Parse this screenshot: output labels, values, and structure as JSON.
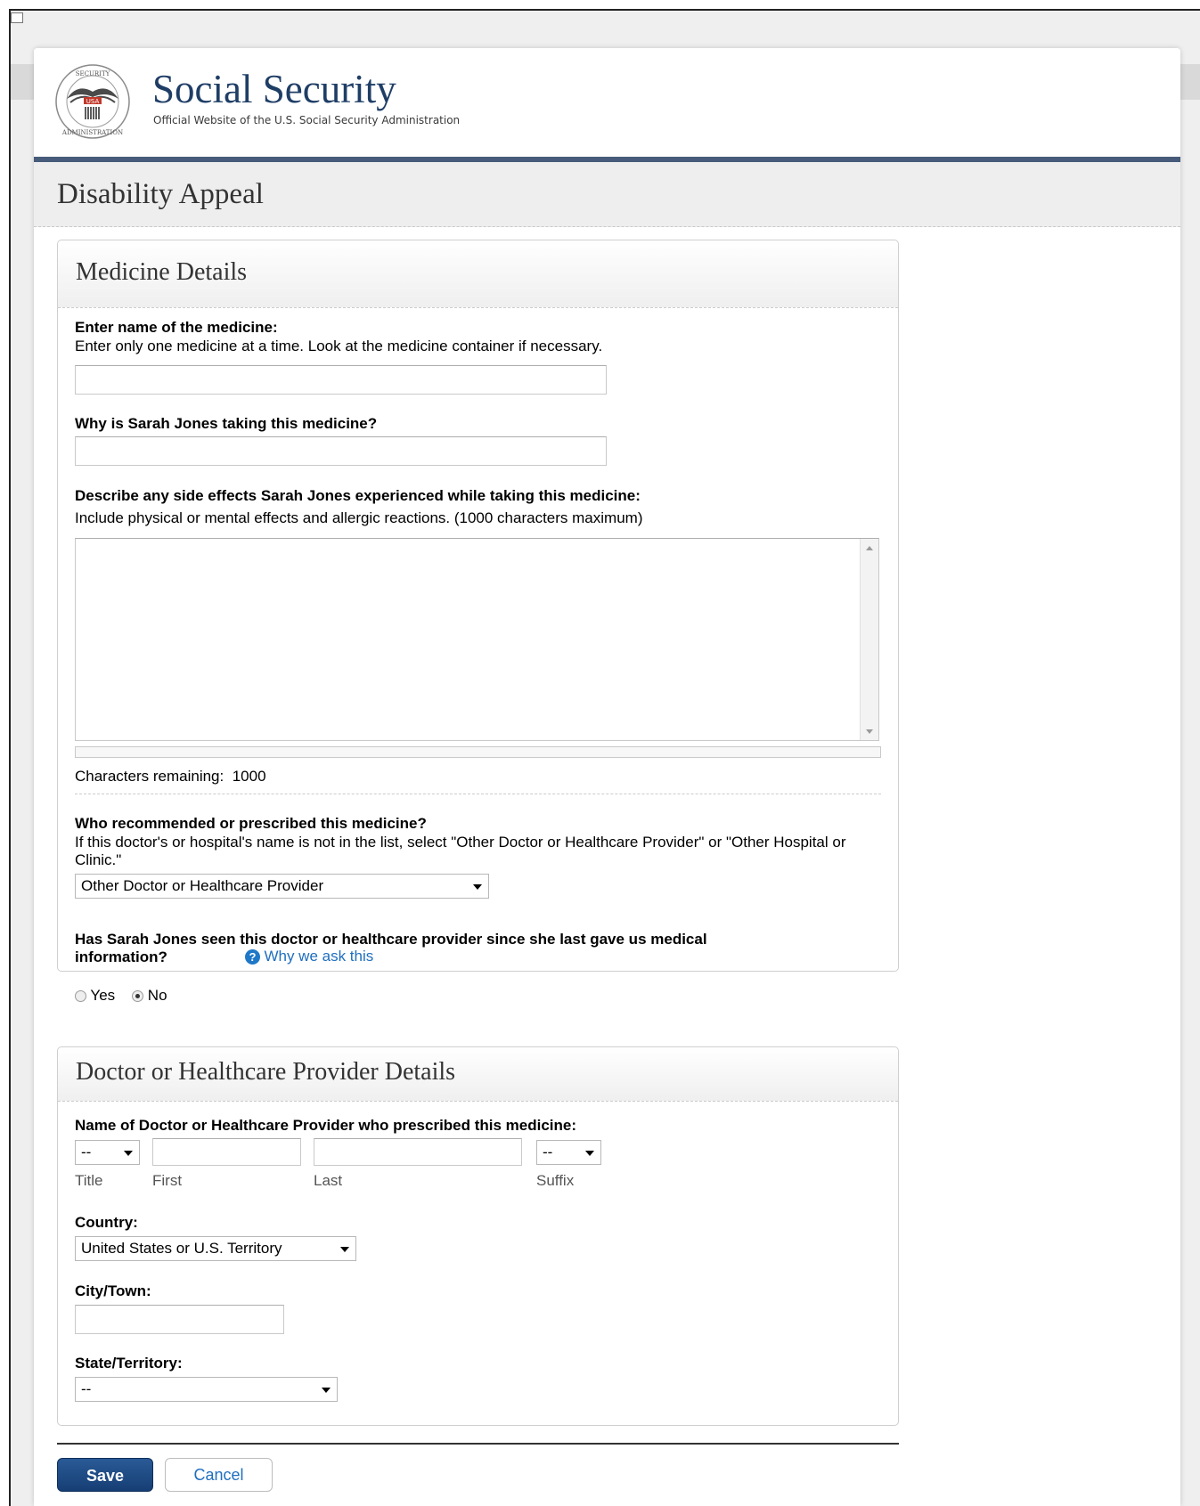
{
  "header": {
    "brand_title": "Social Security",
    "brand_subtitle": "Official Website of the U.S. Social Security Administration",
    "seal_icon": "ssa-seal-icon"
  },
  "page": {
    "title": "Disability Appeal"
  },
  "medicine_panel": {
    "title": "Medicine Details",
    "name_label": "Enter name of the medicine:",
    "name_hint": "Enter only one medicine at a time. Look at the medicine container if necessary.",
    "name_value": "",
    "why_label": "Why is Sarah Jones taking this medicine?",
    "why_value": "",
    "side_effects_label": "Describe any side effects Sarah Jones experienced while taking this medicine:",
    "side_effects_hint": "Include physical or mental effects and allergic reactions. (1000 characters maximum)",
    "side_effects_value": "",
    "chars_remaining_label": "Characters remaining:",
    "chars_remaining_value": "1000",
    "prescriber_label": "Who recommended or prescribed this medicine?",
    "prescriber_hint": "If this doctor's or hospital's name is not in the list, select \"Other Doctor or Healthcare Provider\" or \"Other Hospital or Clinic.\"",
    "prescriber_selected": "Other Doctor or Healthcare Provider",
    "seen_question_line1": "Has Sarah Jones seen this doctor or healthcare provider since she last gave us medical",
    "seen_question_line2": "information?",
    "why_ask_link": "Why we ask this",
    "radio_yes": "Yes",
    "radio_no": "No",
    "radio_selected": "No"
  },
  "doctor_panel": {
    "title": "Doctor or Healthcare Provider Details",
    "name_label": "Name of Doctor or Healthcare Provider who prescribed this medicine:",
    "title_select": "--",
    "suffix_select": "--",
    "title_caption": "Title",
    "first_caption": "First",
    "last_caption": "Last",
    "suffix_caption": "Suffix",
    "first_value": "",
    "last_value": "",
    "country_label": "Country:",
    "country_selected": "United States or U.S. Territory",
    "city_label": "City/Town:",
    "city_value": "",
    "state_label": "State/Territory:",
    "state_selected": "--"
  },
  "actions": {
    "save": "Save",
    "cancel": "Cancel"
  },
  "colors": {
    "brand_navy": "#1f3e66",
    "header_rule": "#475b7a",
    "link_blue": "#1f6fbf",
    "save_button": "#1f4a85"
  }
}
